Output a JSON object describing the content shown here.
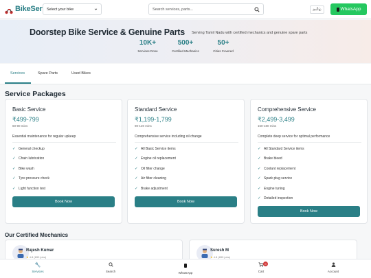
{
  "header": {
    "logo_text": "BikeServ",
    "bike_select": "Select your bike",
    "search_placeholder": "Search services, parts...",
    "lang_label": "தமிழ்",
    "whatsapp_label": "WhatsApp"
  },
  "hero": {
    "title": "Doorstep Bike Service & Genuine Parts",
    "subtitle": "Serving Tamil Nadu with certified mechanics and genuine spare parts",
    "stats": [
      {
        "num": "10K+",
        "label": "Services Done"
      },
      {
        "num": "500+",
        "label": "Certified Mechanics"
      },
      {
        "num": "50+",
        "label": "Cities Covered"
      }
    ]
  },
  "tabs": [
    "Services",
    "Spare Parts",
    "Used Bikes"
  ],
  "section_title": "Service Packages",
  "packages": [
    {
      "name": "Basic Service",
      "price": "₹499-799",
      "duration": "60-90 mins",
      "desc": "Essential maintenance for regular upkeep",
      "features": [
        "General checkup",
        "Chain lubrication",
        "Bike wash",
        "Tyre pressure check",
        "Light function test"
      ],
      "cta": "Book Now"
    },
    {
      "name": "Standard Service",
      "price": "₹1,199-1,799",
      "duration": "90-120 mins",
      "desc": "Comprehensive service including oil change",
      "features": [
        "All Basic Service items",
        "Engine oil replacement",
        "Oil filter change",
        "Air filter cleaning",
        "Brake adjustment"
      ],
      "cta": "Book Now"
    },
    {
      "name": "Comprehensive Service",
      "price": "₹2,499-3,499",
      "duration": "150-180 mins",
      "desc": "Complete deep service for optimal performance",
      "features": [
        "All Standard Service items",
        "Brake bleed",
        "Coolant replacement",
        "Spark plug service",
        "Engine tuning",
        "Detailed inspection"
      ],
      "cta": "Book Now"
    }
  ],
  "mechanics": {
    "title": "Our Certified Mechanics",
    "items": [
      {
        "name": "Rajesh Kumar",
        "rating": "4.8 (890 jobs)"
      },
      {
        "name": "Suresh M",
        "rating": "4.8 (890 jobs)"
      }
    ]
  },
  "bottom_nav": {
    "items": [
      {
        "label": "Services",
        "icon": "wrench-icon"
      },
      {
        "label": "Search",
        "icon": "search-icon"
      },
      {
        "label": "WhatsApp",
        "icon": "phone-icon"
      },
      {
        "label": "Cart",
        "icon": "cart-icon"
      },
      {
        "label": "Account",
        "icon": "user-icon"
      }
    ],
    "cart_count": "0"
  },
  "colors": {
    "accent": "#2a7f86",
    "whatsapp": "#25c860",
    "badge": "#d23b3b"
  }
}
